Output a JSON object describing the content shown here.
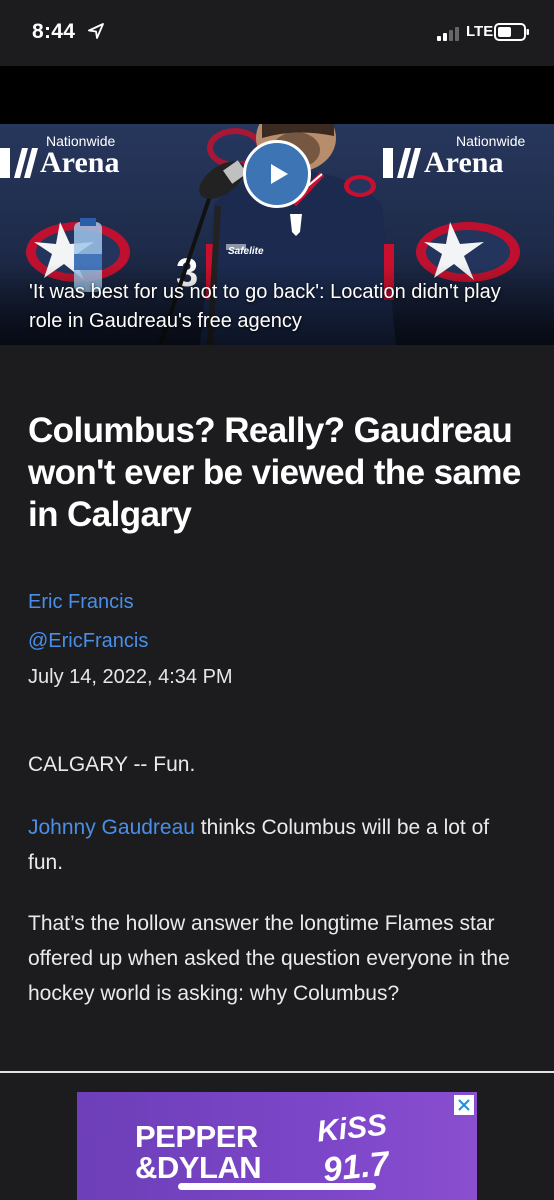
{
  "status_bar": {
    "time": "8:44",
    "network": "LTE"
  },
  "hero": {
    "caption": "'It was best for us not to go back': Location didn't play role in Gaudreau's free agency",
    "arena_brand_top": "Nationwide",
    "arena_brand_bottom": "Arena",
    "sponsor": "Safelite",
    "jersey_number": "3"
  },
  "article": {
    "headline": "Columbus? Really? Gaudreau won't ever be viewed the same in Calgary",
    "author": "Eric Francis",
    "handle": "@EricFrancis",
    "date": "July 14, 2022, 4:34 PM",
    "paragraphs": {
      "p1": "CALGARY -- Fun.",
      "p2_link": "Johnny Gaudreau",
      "p2_rest": " thinks Columbus will be a lot of fun.",
      "p3": "That’s the hollow answer the longtime Flames star offered up when asked the question everyone in the hockey world is asking: why Columbus?"
    }
  },
  "ad": {
    "title_line1": "PEPPER",
    "title_line2": "&DYLAN",
    "station": "KiSS",
    "frequency": "91.7"
  },
  "colors": {
    "link": "#4a8fe7",
    "background": "#1c1c1e",
    "play_button": "#3d74b4",
    "ad_purple": "#7c46c8"
  }
}
